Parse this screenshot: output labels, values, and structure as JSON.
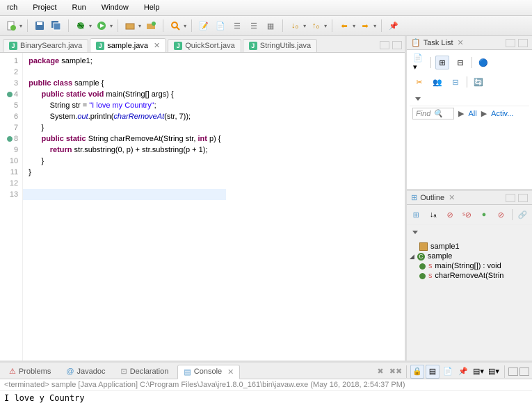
{
  "menu": {
    "items": [
      "rch",
      "Project",
      "Run",
      "Window",
      "Help"
    ]
  },
  "editor_tabs": [
    {
      "label": "BinarySearch.java",
      "active": false
    },
    {
      "label": "sample.java",
      "active": true
    },
    {
      "label": "QuickSort.java",
      "active": false
    },
    {
      "label": "StringUtils.java",
      "active": false
    }
  ],
  "code": {
    "lines": [
      {
        "n": "1",
        "html": "<span class='kw'>package</span> sample1;"
      },
      {
        "n": "2",
        "html": ""
      },
      {
        "n": "3",
        "html": "<span class='kw'>public class</span> sample {"
      },
      {
        "n": "4",
        "mark": true,
        "html": "      <span class='kw'>public static void</span> main(String[] args) {"
      },
      {
        "n": "5",
        "html": "          String str = <span class='str'>\"I love my Country\"</span>;"
      },
      {
        "n": "6",
        "html": "          System.<span class='fld'>out</span>.println(<span class='fld'>charRemoveAt</span>(str, 7));"
      },
      {
        "n": "7",
        "html": "      }"
      },
      {
        "n": "8",
        "mark": true,
        "html": "      <span class='kw'>public static</span> String charRemoveAt(String str, <span class='kw'>int</span> p) {"
      },
      {
        "n": "9",
        "html": "          <span class='kw'>return</span> str.substring(0, p) + str.substring(p + 1);"
      },
      {
        "n": "10",
        "html": "      }"
      },
      {
        "n": "11",
        "html": "}"
      },
      {
        "n": "12",
        "html": ""
      },
      {
        "n": "13",
        "cur": true,
        "html": ""
      }
    ]
  },
  "tasklist": {
    "title": "Task List",
    "find": "Find",
    "all": "All",
    "activ": "Activ..."
  },
  "outline": {
    "title": "Outline",
    "pkg": "sample1",
    "cls": "sample",
    "m1": "main(String[]) : void",
    "m2": "charRemoveAt(Strin"
  },
  "bottom": {
    "tabs": [
      {
        "label": "Problems",
        "icon": "problems-icon"
      },
      {
        "label": "Javadoc",
        "icon": "javadoc-icon"
      },
      {
        "label": "Declaration",
        "icon": "declaration-icon"
      },
      {
        "label": "Console",
        "icon": "console-icon",
        "active": true
      }
    ],
    "term": "<terminated> sample [Java Application] C:\\Program Files\\Java\\jre1.8.0_161\\bin\\javaw.exe (May 16, 2018, 2:54:37 PM)",
    "output": "I love y Country"
  }
}
